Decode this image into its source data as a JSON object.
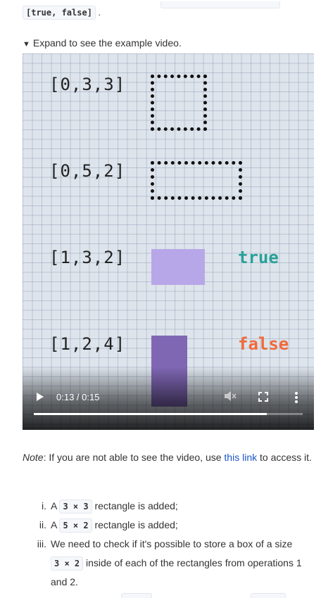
{
  "top": {
    "chip_text": "[true, false]",
    "trailing": "."
  },
  "expand": {
    "arrow": "▼",
    "label": "Expand to see the example video."
  },
  "video": {
    "rows": [
      {
        "op": "[0,3,3]"
      },
      {
        "op": "[0,5,2]"
      },
      {
        "op": "[1,3,2]",
        "result": "true"
      },
      {
        "op": "[1,2,4]",
        "result": "false"
      }
    ],
    "colors": {
      "added_border": "#111111",
      "fits_fill": "#b8a7e8",
      "not_fits_fill": "#8067b4",
      "true_text": "#2aa198",
      "false_text": "#f06a3a"
    },
    "controls": {
      "play_icon": "play-icon",
      "time": "0:13 / 0:15",
      "progress_fraction": 0.867,
      "volume_icon": "volume-muted-icon",
      "fullscreen_icon": "fullscreen-icon",
      "more_icon": "more-vertical-icon"
    }
  },
  "note": {
    "label": "Note",
    "text_before": ": If you are not able to see the video, use ",
    "link": "this link",
    "text_after": " to access it."
  },
  "list": [
    {
      "num": "i.",
      "before": "A ",
      "code": "3 × 3",
      "after": " rectangle is added;"
    },
    {
      "num": "ii.",
      "before": "A ",
      "code": "5 × 2",
      "after": " rectangle is added;"
    },
    {
      "num": "iii.",
      "before": "We need to check if it's possible to store a box of a size ",
      "code": "3 × 2",
      "after": " inside of each of the rectangles from operations 1 and 2."
    }
  ]
}
